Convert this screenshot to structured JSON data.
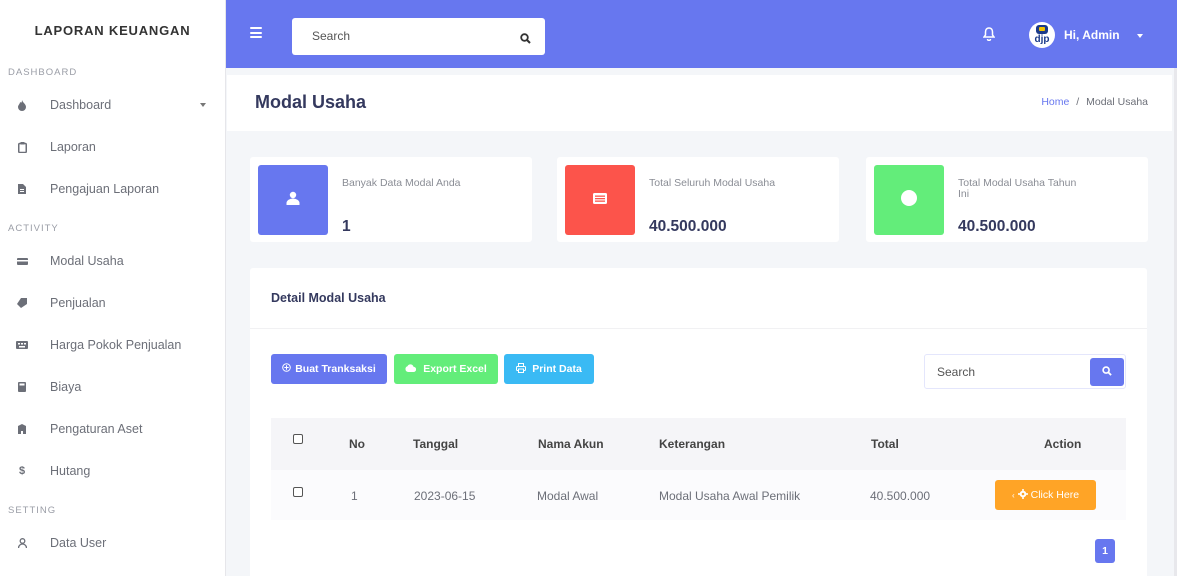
{
  "sidebar": {
    "brand": "LAPORAN KEUANGAN",
    "sections": [
      {
        "label": "DASHBOARD",
        "items": [
          {
            "label": "Dashboard",
            "icon": "fire-icon",
            "has_caret": true
          },
          {
            "label": "Laporan",
            "icon": "clipboard-icon"
          },
          {
            "label": "Pengajuan Laporan",
            "icon": "file-icon"
          }
        ]
      },
      {
        "label": "ACTIVITY",
        "items": [
          {
            "label": "Modal Usaha",
            "icon": "wallet-icon"
          },
          {
            "label": "Penjualan",
            "icon": "tag-icon"
          },
          {
            "label": "Harga Pokok Penjualan",
            "icon": "keyboard-icon"
          },
          {
            "label": "Biaya",
            "icon": "calculator-icon"
          },
          {
            "label": "Pengaturan Aset",
            "icon": "building-icon"
          },
          {
            "label": "Hutang",
            "icon": "dollar-icon"
          }
        ]
      },
      {
        "label": "SETTING",
        "items": [
          {
            "label": "Data User",
            "icon": "user-icon"
          }
        ]
      }
    ]
  },
  "topbar": {
    "search_placeholder": "Search",
    "avatar_text": "djp",
    "user_greeting": "Hi, Admin"
  },
  "page": {
    "title": "Modal Usaha",
    "breadcrumb_home": "Home",
    "breadcrumb_sep": "/",
    "breadcrumb_current": "Modal Usaha"
  },
  "stats": [
    {
      "label": "Banyak Data Modal Anda",
      "value": "1",
      "color": "#6777ef",
      "icon": "user-icon"
    },
    {
      "label": "Total Seluruh Modal Usaha",
      "value": "40.500.000",
      "color": "#fc544b",
      "icon": "receipt-icon"
    },
    {
      "label": "Total Modal Usaha Tahun Ini",
      "value": "40.500.000",
      "color": "#63ed7a",
      "icon": "circle-icon"
    }
  ],
  "detail": {
    "title": "Detail Modal Usaha",
    "buttons": {
      "buat": "Buat Tranksaksi",
      "export": "Export Excel",
      "print": "Print Data"
    },
    "search_placeholder": "Search",
    "columns": [
      "No",
      "Tanggal",
      "Nama Akun",
      "Keterangan",
      "Total",
      "Action"
    ],
    "rows": [
      {
        "no": "1",
        "tanggal": "2023-06-15",
        "nama_akun": "Modal Awal",
        "keterangan": "Modal Usaha Awal Pemilik",
        "total": "40.500.000",
        "action": "Click Here"
      }
    ],
    "pagination_current": "1"
  }
}
